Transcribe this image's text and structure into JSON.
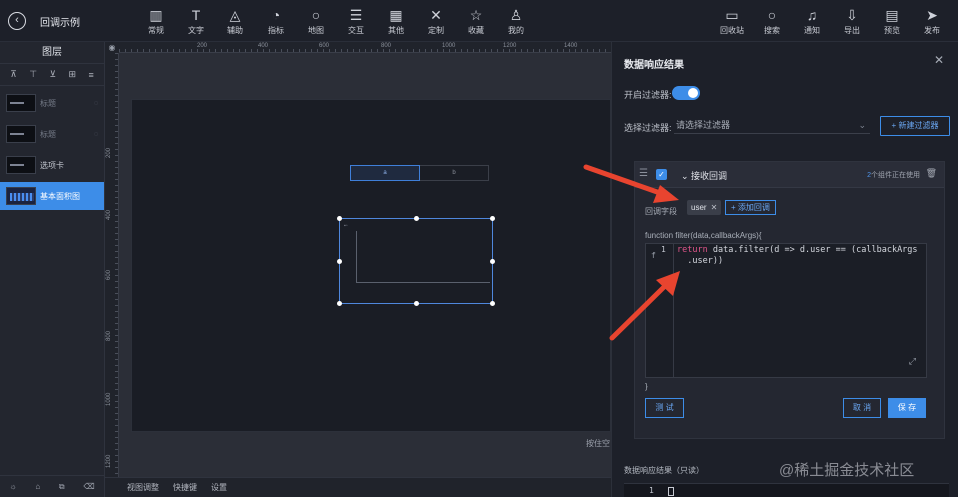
{
  "app": {
    "title": "回调示例"
  },
  "toolbar": {
    "left_tools": [
      {
        "icon": "bar-chart-icon",
        "label": "常规"
      },
      {
        "icon": "text-icon",
        "label": "文字"
      },
      {
        "icon": "shapes-icon",
        "label": "辅助"
      },
      {
        "icon": "indicator-icon",
        "label": "指标"
      },
      {
        "icon": "map-pin-icon",
        "label": "地图"
      },
      {
        "icon": "sliders-icon",
        "label": "交互"
      },
      {
        "icon": "grid-icon",
        "label": "其他"
      },
      {
        "icon": "tools-icon",
        "label": "定制"
      },
      {
        "icon": "star-icon",
        "label": "收藏"
      },
      {
        "icon": "user-icon",
        "label": "我的"
      }
    ],
    "right_tools": [
      {
        "icon": "trash-bin-icon",
        "label": "回收站"
      },
      {
        "icon": "search-icon",
        "label": "搜索"
      },
      {
        "icon": "bell-icon",
        "label": "通知"
      },
      {
        "icon": "export-icon",
        "label": "导出"
      },
      {
        "icon": "preview-icon",
        "label": "预览"
      },
      {
        "icon": "send-icon",
        "label": "发布"
      }
    ]
  },
  "layers_panel": {
    "title": "图层",
    "layers": [
      {
        "name": "标题",
        "dim": true
      },
      {
        "name": "标题",
        "dim": true
      },
      {
        "name": "选项卡",
        "dim": false
      },
      {
        "name": "基本面积图",
        "dim": false,
        "active": true
      }
    ]
  },
  "canvas": {
    "ruler_top": [
      "200",
      "400",
      "600",
      "800",
      "1000",
      "1200",
      "1400"
    ],
    "ruler_left": [
      "200",
      "400",
      "600",
      "800",
      "1000",
      "1200"
    ],
    "tabs": [
      "a",
      "b"
    ],
    "hint": "按住空"
  },
  "canvas_bottom": [
    "视图调整",
    "快捷键",
    "设置"
  ],
  "panel": {
    "title": "数据响应结果",
    "filter_toggle_label": "开启过滤器:",
    "filter_enabled": true,
    "select_label": "选择过滤器:",
    "select_placeholder": "请选择过滤器",
    "new_filter_label": "+ 新建过滤器",
    "filter": {
      "name": "接收回调",
      "usage_count": "2",
      "usage_text": "个组件正在使用",
      "callback_label": "回调字段",
      "chip": "user",
      "add_callback": "+ 添加回调",
      "signature": "function filter(data,callbackArgs){",
      "line_number": "1",
      "code_keyword": "return",
      "code_line1": " data.filter(d => d.user == (callbackArgs",
      "code_line2": "  .user))",
      "closing": "}",
      "test_label": "测 试",
      "cancel_label": "取 消",
      "save_label": "保 存"
    },
    "result_label": "数据响应结果（只读）",
    "result_line": "1"
  },
  "watermark": "@稀土掘金技术社区",
  "colors": {
    "accent": "#3d8de8",
    "arrow": "#e8442f",
    "keyword": "#e0558a"
  }
}
